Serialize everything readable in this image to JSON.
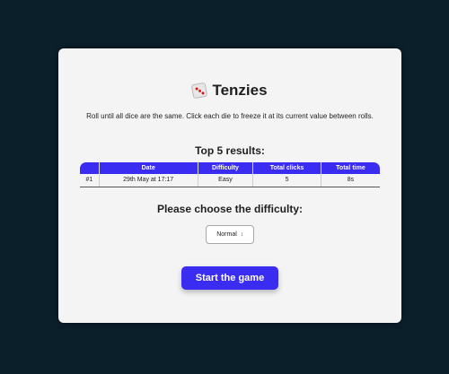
{
  "app": {
    "title": "Tenzies",
    "description": "Roll until all dice are the same. Click each die to freeze it at its current value between rolls."
  },
  "results": {
    "heading": "Top 5 results:",
    "columns": [
      "",
      "Date",
      "Difficulty",
      "Total clicks",
      "Total time"
    ],
    "rows": [
      {
        "rank": "#1",
        "date": "29th May at 17:17",
        "difficulty": "Easy",
        "clicks": "5",
        "time": "8s"
      }
    ]
  },
  "difficulty": {
    "heading": "Please choose the difficulty:",
    "selected": "Normal"
  },
  "start_button": {
    "label": "Start the game"
  },
  "colors": {
    "accent": "#3a2cf0",
    "background": "#0b1f2b",
    "card": "#f4f4f4"
  },
  "icons": {
    "title_icon": "die-icon",
    "select_icon": "chevron-up-down-icon"
  }
}
